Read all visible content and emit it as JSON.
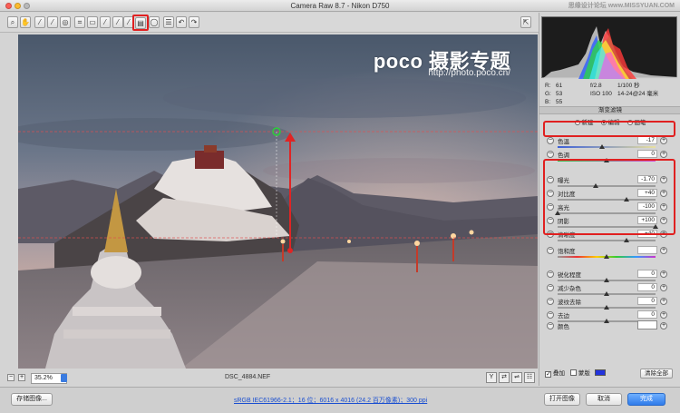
{
  "window": {
    "title": "Camera Raw 8.7  -  Nikon D750",
    "watermark": "思缘设计论坛  www.MISSYUAN.COM"
  },
  "toolbar": {
    "tools": [
      "zoom-icon",
      "hand-icon",
      "white-balance-icon",
      "color-sampler-icon",
      "target-adjust-icon",
      "crop-icon",
      "straighten-icon",
      "spot-removal-icon",
      "red-eye-icon",
      "adjustment-brush-icon",
      "graduated-filter-icon",
      "radial-filter-icon",
      "preferences-icon",
      "rotate-left-icon",
      "rotate-right-icon"
    ],
    "highlighted": "graduated-filter-icon"
  },
  "photo": {
    "logo_text": "poco 摄影专题",
    "logo_url": "http://photo.poco.cn/",
    "filename": "DSC_4884.NEF",
    "zoom": "35.2%"
  },
  "histogram": {
    "r_label": "R:",
    "r_value": "61",
    "g_label": "G:",
    "g_value": "53",
    "b_label": "B:",
    "b_value": "55",
    "aperture": "f/2.8",
    "shutter": "1/100 秒",
    "iso": "ISO 100",
    "lens": "14-24@24 毫米"
  },
  "panel": {
    "section_title": "渐变滤镜",
    "modes": [
      "新建",
      "编辑",
      "画笔"
    ],
    "active_mode": "编辑",
    "sliders": [
      {
        "label": "色温",
        "value": "-17",
        "pos": 0.45,
        "group": 1,
        "track": "temp"
      },
      {
        "label": "色调",
        "value": "0",
        "pos": 0.5,
        "group": 0,
        "track": "tint"
      },
      {
        "label": "曝光",
        "value": "-1.70",
        "pos": 0.39,
        "group": 2,
        "track": "plain"
      },
      {
        "label": "对比度",
        "value": "+40",
        "pos": 0.7,
        "group": 2,
        "track": "plain"
      },
      {
        "label": "高光",
        "value": "-100",
        "pos": 0.0,
        "group": 2,
        "track": "plain"
      },
      {
        "label": "阴影",
        "value": "+100",
        "pos": 1.0,
        "group": 2,
        "track": "plain"
      },
      {
        "label": "清晰度",
        "value": "+40",
        "pos": 0.7,
        "group": 2,
        "track": "plain"
      },
      {
        "label": "饱和度",
        "value": "",
        "pos": 0.5,
        "group": 0,
        "track": "sat"
      },
      {
        "label": "锐化程度",
        "value": "0",
        "pos": 0.5,
        "group": 0,
        "track": "plain"
      },
      {
        "label": "减少杂色",
        "value": "0",
        "pos": 0.5,
        "group": 0,
        "track": "plain"
      },
      {
        "label": "波纹去除",
        "value": "0",
        "pos": 0.5,
        "group": 0,
        "track": "plain"
      },
      {
        "label": "去边",
        "value": "0",
        "pos": 0.5,
        "group": 0,
        "track": "plain"
      }
    ],
    "color_label": "颜色",
    "overlay_label": "叠加",
    "mask_label": "蒙版",
    "mask_color": "#2233dd",
    "clear_all": "清除全部"
  },
  "footer": {
    "save_image": "存储图像...",
    "workflow": "sRGB IEC61966-2.1；16 位；6016 x 4016 (24.2 百万像素)；300 ppi",
    "open_image": "打开图像",
    "cancel": "取消",
    "done": "完成"
  }
}
